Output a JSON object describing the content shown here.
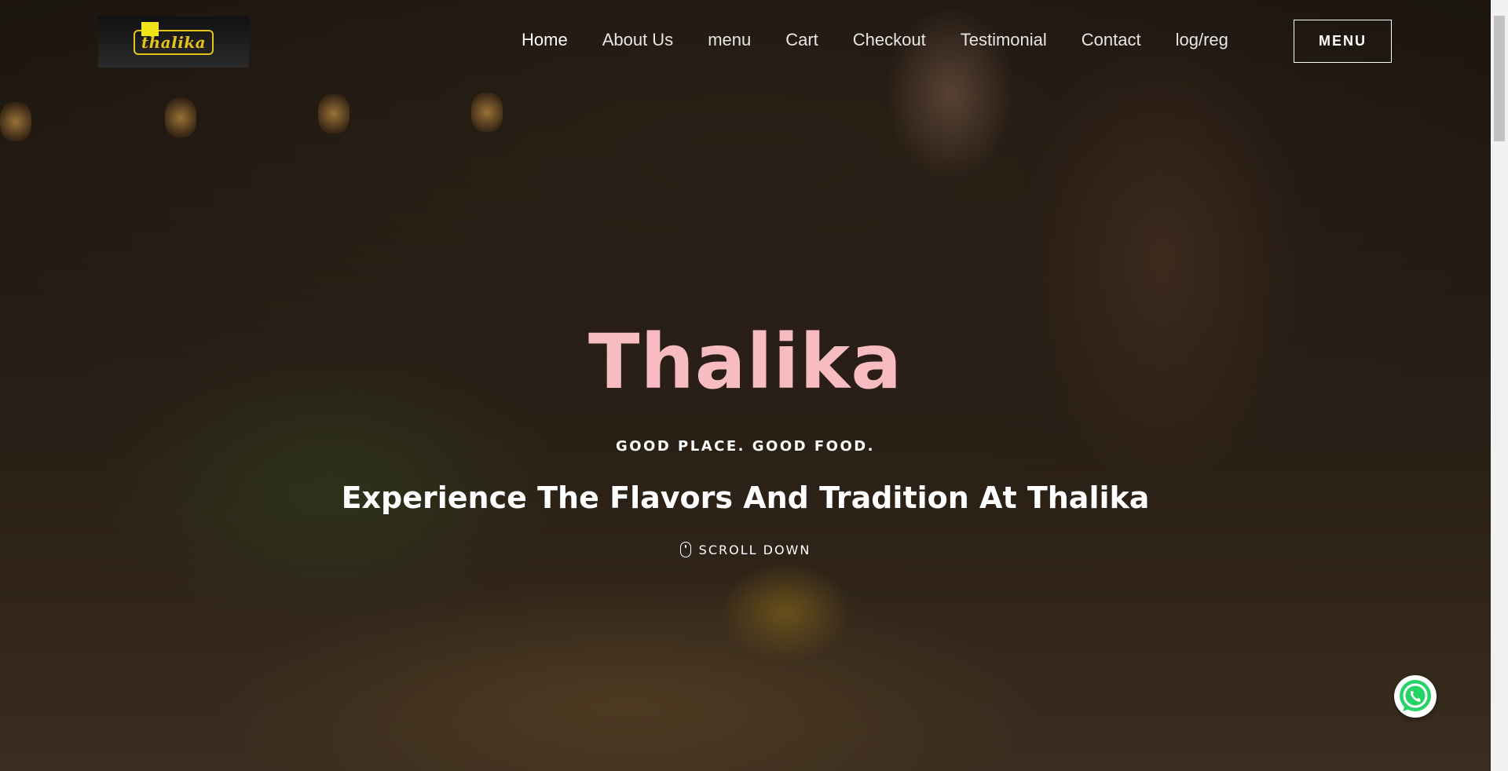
{
  "logo": {
    "text": "thalika",
    "alt": "Thalika logo"
  },
  "nav": {
    "items": [
      {
        "label": "Home",
        "active": true
      },
      {
        "label": "About Us"
      },
      {
        "label": "menu"
      },
      {
        "label": "Cart"
      },
      {
        "label": "Checkout"
      },
      {
        "label": "Testimonial"
      },
      {
        "label": "Contact"
      },
      {
        "label": "log/reg"
      }
    ],
    "menu_button": "MENU"
  },
  "hero": {
    "title": "Thalika",
    "tagline": "GOOD PLACE. GOOD FOOD.",
    "headline": "Experience The Flavors And Tradition At Thalika",
    "scroll_label": "SCROLL DOWN"
  },
  "colors": {
    "title_pink": "#f6bcc2",
    "logo_yellow": "#e3c21a",
    "whatsapp_green": "#25d366"
  },
  "icons": {
    "scroll": "mouse-icon",
    "chat": "whatsapp-icon"
  }
}
